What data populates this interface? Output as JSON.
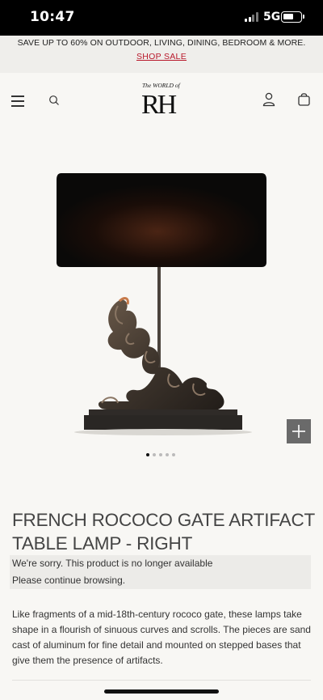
{
  "status_bar": {
    "time": "10:47",
    "network": "5G",
    "icons": [
      "signal-icon",
      "battery-icon"
    ]
  },
  "promo": {
    "text": "SAVE UP TO 60% ON OUTDOOR, LIVING, DINING, BEDROOM & MORE.",
    "link": "SHOP SALE",
    "link_color": "#b8172a"
  },
  "header": {
    "logo_top": "The WORLD of",
    "logo_main": "RH",
    "icons": [
      "menu-icon",
      "search-icon",
      "account-icon",
      "shopping-bag-icon"
    ]
  },
  "gallery": {
    "image_count": 5,
    "active_index": 0,
    "zoom_icon": "plus-icon"
  },
  "product": {
    "title": "FRENCH ROCOCO GATE ARTIFACT TABLE LAMP - RIGHT",
    "unavailable_message": "We're sorry. This product is no longer available",
    "continue_message": "Please continue browsing.",
    "description": "Like fragments of a mid-18th-century rococo gate, these lamps take shape in a flourish of sinuous curves and scrolls. The pieces are sand cast of aluminum for fine detail and mounted on stepped bases that give them the presence of artifacts."
  },
  "colors": {
    "background": "#f8f7f4",
    "promo_background": "#efeeeb",
    "accent": "#b8172a",
    "notice_background": "#ecebe8"
  }
}
